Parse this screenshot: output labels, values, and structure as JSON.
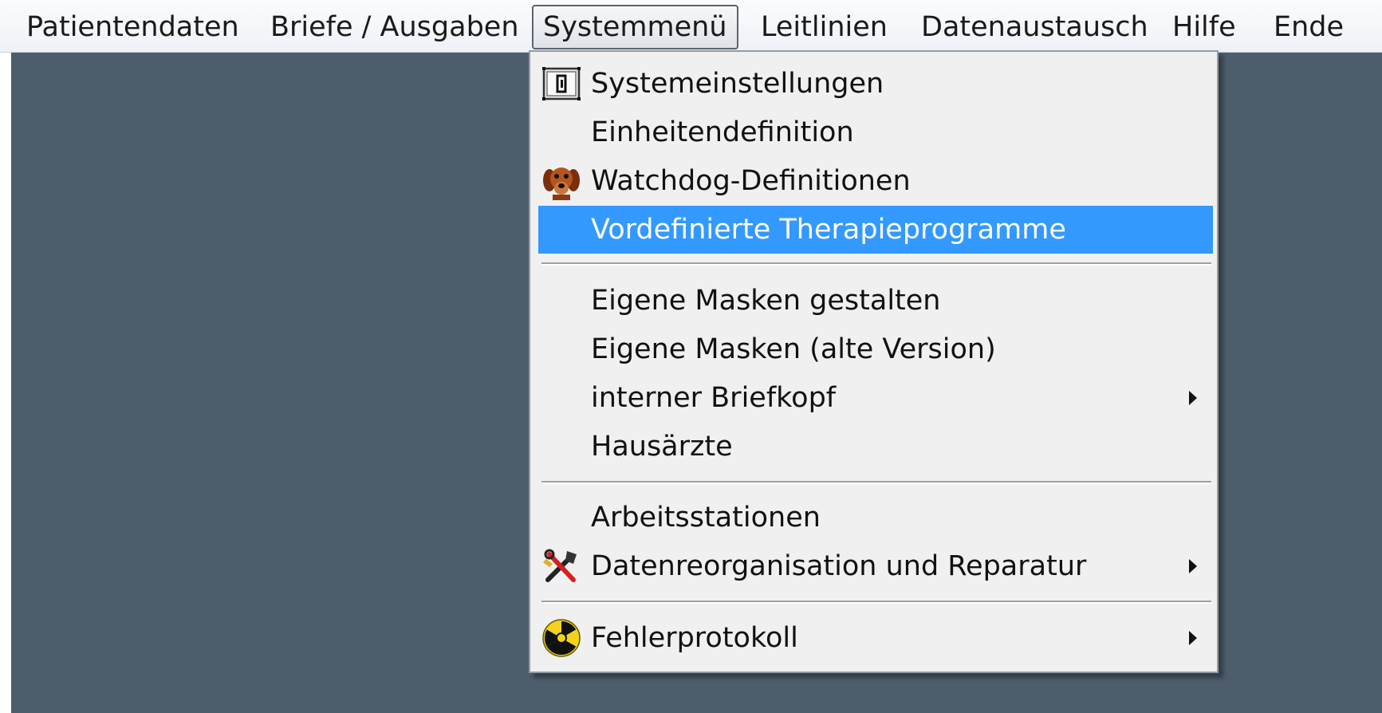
{
  "menubar": {
    "items": [
      {
        "label": "Patientendaten"
      },
      {
        "label": "Briefe / Ausgaben"
      },
      {
        "label": "Systemmenü"
      },
      {
        "label": "Leitlinien"
      },
      {
        "label": "Datenaustausch"
      },
      {
        "label": "Hilfe"
      },
      {
        "label": "Ende"
      }
    ],
    "active_item": "Systemmenü"
  },
  "dropdown": {
    "highlighted_item": "Vordefinierte Therapieprogramme",
    "items": [
      {
        "label": "Systemeinstellungen",
        "icon": "settings-panel-icon"
      },
      {
        "label": "Einheitendefinition"
      },
      {
        "label": "Watchdog-Definitionen",
        "icon": "dog-icon"
      },
      {
        "label": "Vordefinierte Therapieprogramme"
      },
      {
        "label": "Eigene Masken gestalten"
      },
      {
        "label": "Eigene Masken (alte Version)"
      },
      {
        "label": "interner Briefkopf",
        "submenu": true
      },
      {
        "label": "Hausärzte"
      },
      {
        "label": "Arbeitsstationen"
      },
      {
        "label": "Datenreorganisation und Reparatur",
        "icon": "tools-icon",
        "submenu": true
      },
      {
        "label": "Fehlerprotokoll",
        "icon": "radiation-icon",
        "submenu": true
      }
    ]
  },
  "colors": {
    "workspace": "#4d5d6c",
    "menu_background": "#f0f0f0",
    "highlight": "#3399ff"
  }
}
